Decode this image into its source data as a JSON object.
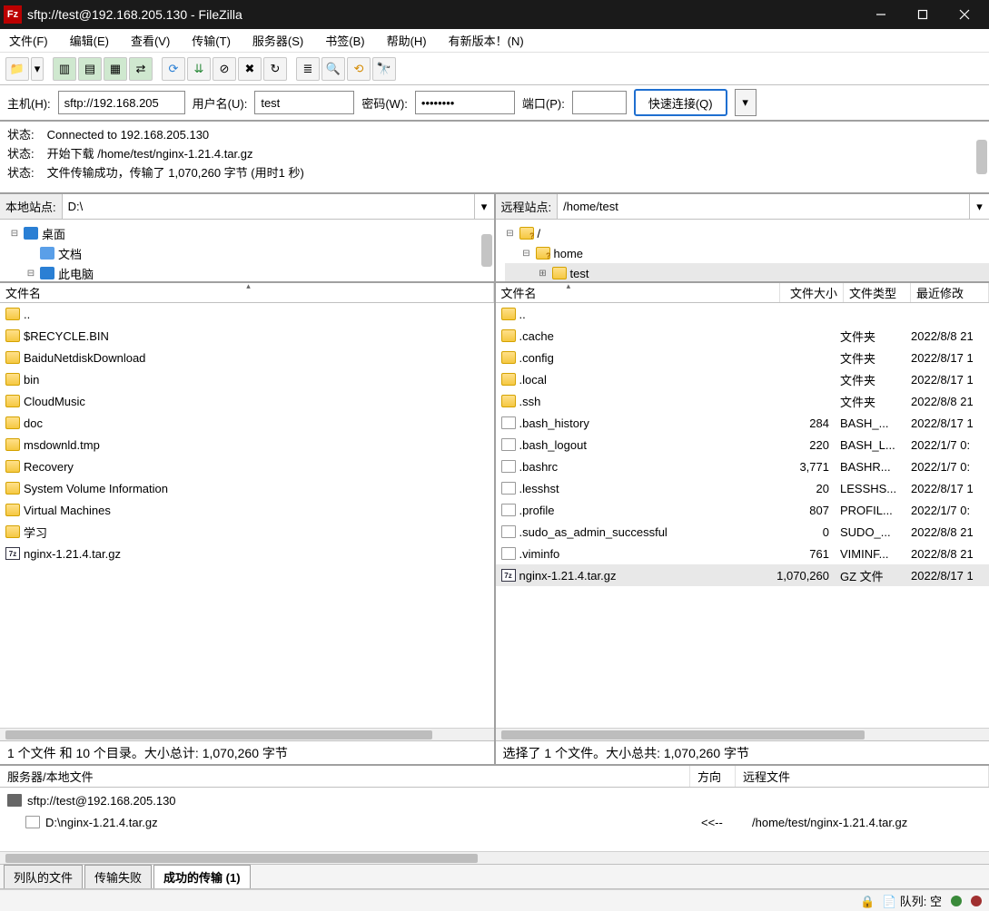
{
  "title": "sftp://test@192.168.205.130 - FileZilla",
  "menu": [
    "文件(F)",
    "编辑(E)",
    "查看(V)",
    "传输(T)",
    "服务器(S)",
    "书签(B)",
    "帮助(H)",
    "有新版本！(N)"
  ],
  "qc": {
    "host_lbl": "主机(H):",
    "host": "sftp://192.168.205",
    "user_lbl": "用户名(U):",
    "user": "test",
    "pass_lbl": "密码(W):",
    "pass": "••••••••",
    "port_lbl": "端口(P):",
    "port": "",
    "btn": "快速连接(Q)"
  },
  "log": {
    "lbl": "状态:",
    "l1": "Connected to 192.168.205.130",
    "l2": "开始下载 /home/test/nginx-1.21.4.tar.gz",
    "l3": "文件传输成功，传输了 1,070,260 字节 (用时1 秒)"
  },
  "local": {
    "site_lbl": "本地站点:",
    "site": "D:\\",
    "tree": [
      {
        "exp": "⊟",
        "ico": "pc",
        "label": "桌面",
        "ind": 0
      },
      {
        "exp": "",
        "ico": "doc",
        "label": "文档",
        "ind": 1
      },
      {
        "exp": "⊟",
        "ico": "pc",
        "label": "此电脑",
        "ind": 1
      }
    ],
    "head_name": "文件名",
    "files": [
      {
        "ico": "folder",
        "name": ".."
      },
      {
        "ico": "folder",
        "name": "$RECYCLE.BIN"
      },
      {
        "ico": "folder",
        "name": "BaiduNetdiskDownload"
      },
      {
        "ico": "folder",
        "name": "bin"
      },
      {
        "ico": "folder",
        "name": "CloudMusic"
      },
      {
        "ico": "folder",
        "name": "doc"
      },
      {
        "ico": "folder",
        "name": "msdownld.tmp"
      },
      {
        "ico": "folder",
        "name": "Recovery"
      },
      {
        "ico": "folder",
        "name": "System Volume Information"
      },
      {
        "ico": "folder",
        "name": "Virtual Machines"
      },
      {
        "ico": "folder",
        "name": "学习"
      },
      {
        "ico": "7z",
        "name": "nginx-1.21.4.tar.gz"
      }
    ],
    "status": "1 个文件 和 10 个目录。大小总计: 1,070,260 字节"
  },
  "remote": {
    "site_lbl": "远程站点:",
    "site": "/home/test",
    "tree": [
      {
        "exp": "⊟",
        "ico": "folder-q",
        "label": "/",
        "ind": 0
      },
      {
        "exp": "⊟",
        "ico": "folder-q",
        "label": "home",
        "ind": 1
      },
      {
        "exp": "⊞",
        "ico": "folder",
        "label": "test",
        "ind": 2,
        "sel": true
      }
    ],
    "head": {
      "name": "文件名",
      "size": "文件大小",
      "type": "文件类型",
      "date": "最近修改"
    },
    "files": [
      {
        "ico": "folder",
        "name": "..",
        "size": "",
        "type": "",
        "date": ""
      },
      {
        "ico": "folder",
        "name": ".cache",
        "size": "",
        "type": "文件夹",
        "date": "2022/8/8 21"
      },
      {
        "ico": "folder",
        "name": ".config",
        "size": "",
        "type": "文件夹",
        "date": "2022/8/17 1"
      },
      {
        "ico": "folder",
        "name": ".local",
        "size": "",
        "type": "文件夹",
        "date": "2022/8/17 1"
      },
      {
        "ico": "folder",
        "name": ".ssh",
        "size": "",
        "type": "文件夹",
        "date": "2022/8/8 21"
      },
      {
        "ico": "file",
        "name": ".bash_history",
        "size": "284",
        "type": "BASH_...",
        "date": "2022/8/17 1"
      },
      {
        "ico": "file",
        "name": ".bash_logout",
        "size": "220",
        "type": "BASH_L...",
        "date": "2022/1/7 0:"
      },
      {
        "ico": "file",
        "name": ".bashrc",
        "size": "3,771",
        "type": "BASHR...",
        "date": "2022/1/7 0:"
      },
      {
        "ico": "file",
        "name": ".lesshst",
        "size": "20",
        "type": "LESSHS...",
        "date": "2022/8/17 1"
      },
      {
        "ico": "file",
        "name": ".profile",
        "size": "807",
        "type": "PROFIL...",
        "date": "2022/1/7 0:"
      },
      {
        "ico": "file",
        "name": ".sudo_as_admin_successful",
        "size": "0",
        "type": "SUDO_...",
        "date": "2022/8/8 21"
      },
      {
        "ico": "file",
        "name": ".viminfo",
        "size": "761",
        "type": "VIMINF...",
        "date": "2022/8/8 21"
      },
      {
        "ico": "7z",
        "name": "nginx-1.21.4.tar.gz",
        "size": "1,070,260",
        "type": "GZ 文件",
        "date": "2022/8/17 1",
        "sel": true
      }
    ],
    "status": "选择了 1 个文件。大小总共: 1,070,260 字节"
  },
  "queue": {
    "head": {
      "server": "服务器/本地文件",
      "dir": "方向",
      "remote": "远程文件"
    },
    "server": "sftp://test@192.168.205.130",
    "local_file": "D:\\nginx-1.21.4.tar.gz",
    "dir": "<<--",
    "remote_file": "/home/test/nginx-1.21.4.tar.gz"
  },
  "tabs": {
    "queued": "列队的文件",
    "failed": "传输失败",
    "success": "成功的传输  (1)"
  },
  "bottom": {
    "queue": "队列: 空"
  }
}
